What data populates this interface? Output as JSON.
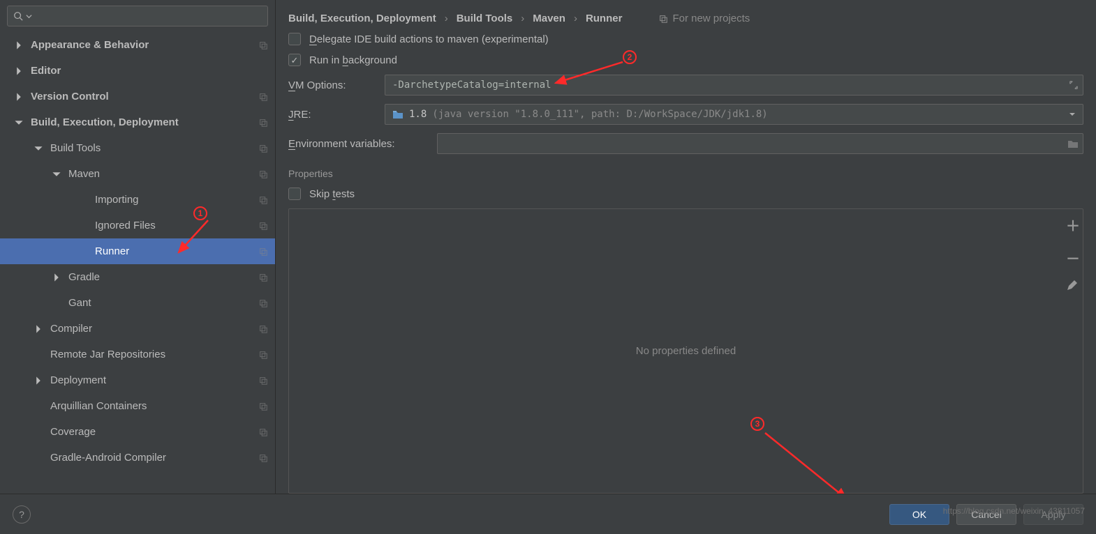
{
  "sidebar": {
    "search_placeholder": "",
    "items": [
      {
        "label": "Appearance & Behavior",
        "level": 0,
        "arrow": "right",
        "copy": true
      },
      {
        "label": "Editor",
        "level": 0,
        "arrow": "right",
        "copy": false
      },
      {
        "label": "Version Control",
        "level": 0,
        "arrow": "right",
        "copy": true
      },
      {
        "label": "Build, Execution, Deployment",
        "level": 0,
        "arrow": "down",
        "copy": true
      },
      {
        "label": "Build Tools",
        "level": 1,
        "arrow": "down",
        "copy": true
      },
      {
        "label": "Maven",
        "level": 2,
        "arrow": "down",
        "copy": true
      },
      {
        "label": "Importing",
        "level": 3,
        "arrow": "none",
        "copy": true
      },
      {
        "label": "Ignored Files",
        "level": 3,
        "arrow": "none",
        "copy": true
      },
      {
        "label": "Runner",
        "level": 3,
        "arrow": "none",
        "copy": true,
        "selected": true
      },
      {
        "label": "Gradle",
        "level": 2,
        "arrow": "right",
        "copy": true
      },
      {
        "label": "Gant",
        "level": 2,
        "arrow": "none",
        "copy": true
      },
      {
        "label": "Compiler",
        "level": 1,
        "arrow": "right",
        "copy": true
      },
      {
        "label": "Remote Jar Repositories",
        "level": 1,
        "arrow": "none",
        "copy": true
      },
      {
        "label": "Deployment",
        "level": 1,
        "arrow": "right",
        "copy": true
      },
      {
        "label": "Arquillian Containers",
        "level": 1,
        "arrow": "none",
        "copy": true
      },
      {
        "label": "Coverage",
        "level": 1,
        "arrow": "none",
        "copy": true
      },
      {
        "label": "Gradle-Android Compiler",
        "level": 1,
        "arrow": "none",
        "copy": true
      }
    ]
  },
  "breadcrumb": {
    "items": [
      "Build, Execution, Deployment",
      "Build Tools",
      "Maven",
      "Runner"
    ],
    "hint": "For new projects"
  },
  "options": {
    "delegate_label": "Delegate IDE build actions to maven (experimental)",
    "delegate_checked": false,
    "background_label": "Run in background",
    "background_checked": true,
    "vm_label": "VM Options:",
    "vm_value": "-DarchetypeCatalog=internal",
    "jre_label": "JRE:",
    "jre_version": "1.8",
    "jre_details": "(java version \"1.8.0_111\", path: D:/WorkSpace/JDK/jdk1.8)",
    "env_label": "Environment variables:",
    "env_value": "",
    "props_section": "Properties",
    "skip_tests_label": "Skip tests",
    "skip_tests_checked": false,
    "props_empty": "No properties defined"
  },
  "footer": {
    "ok": "OK",
    "cancel": "Cancel",
    "apply": "Apply",
    "help": "?"
  },
  "annotations": {
    "one": "1",
    "two": "2",
    "three": "3"
  },
  "watermark": "https://blog.csdn.net/weixin_43811057"
}
